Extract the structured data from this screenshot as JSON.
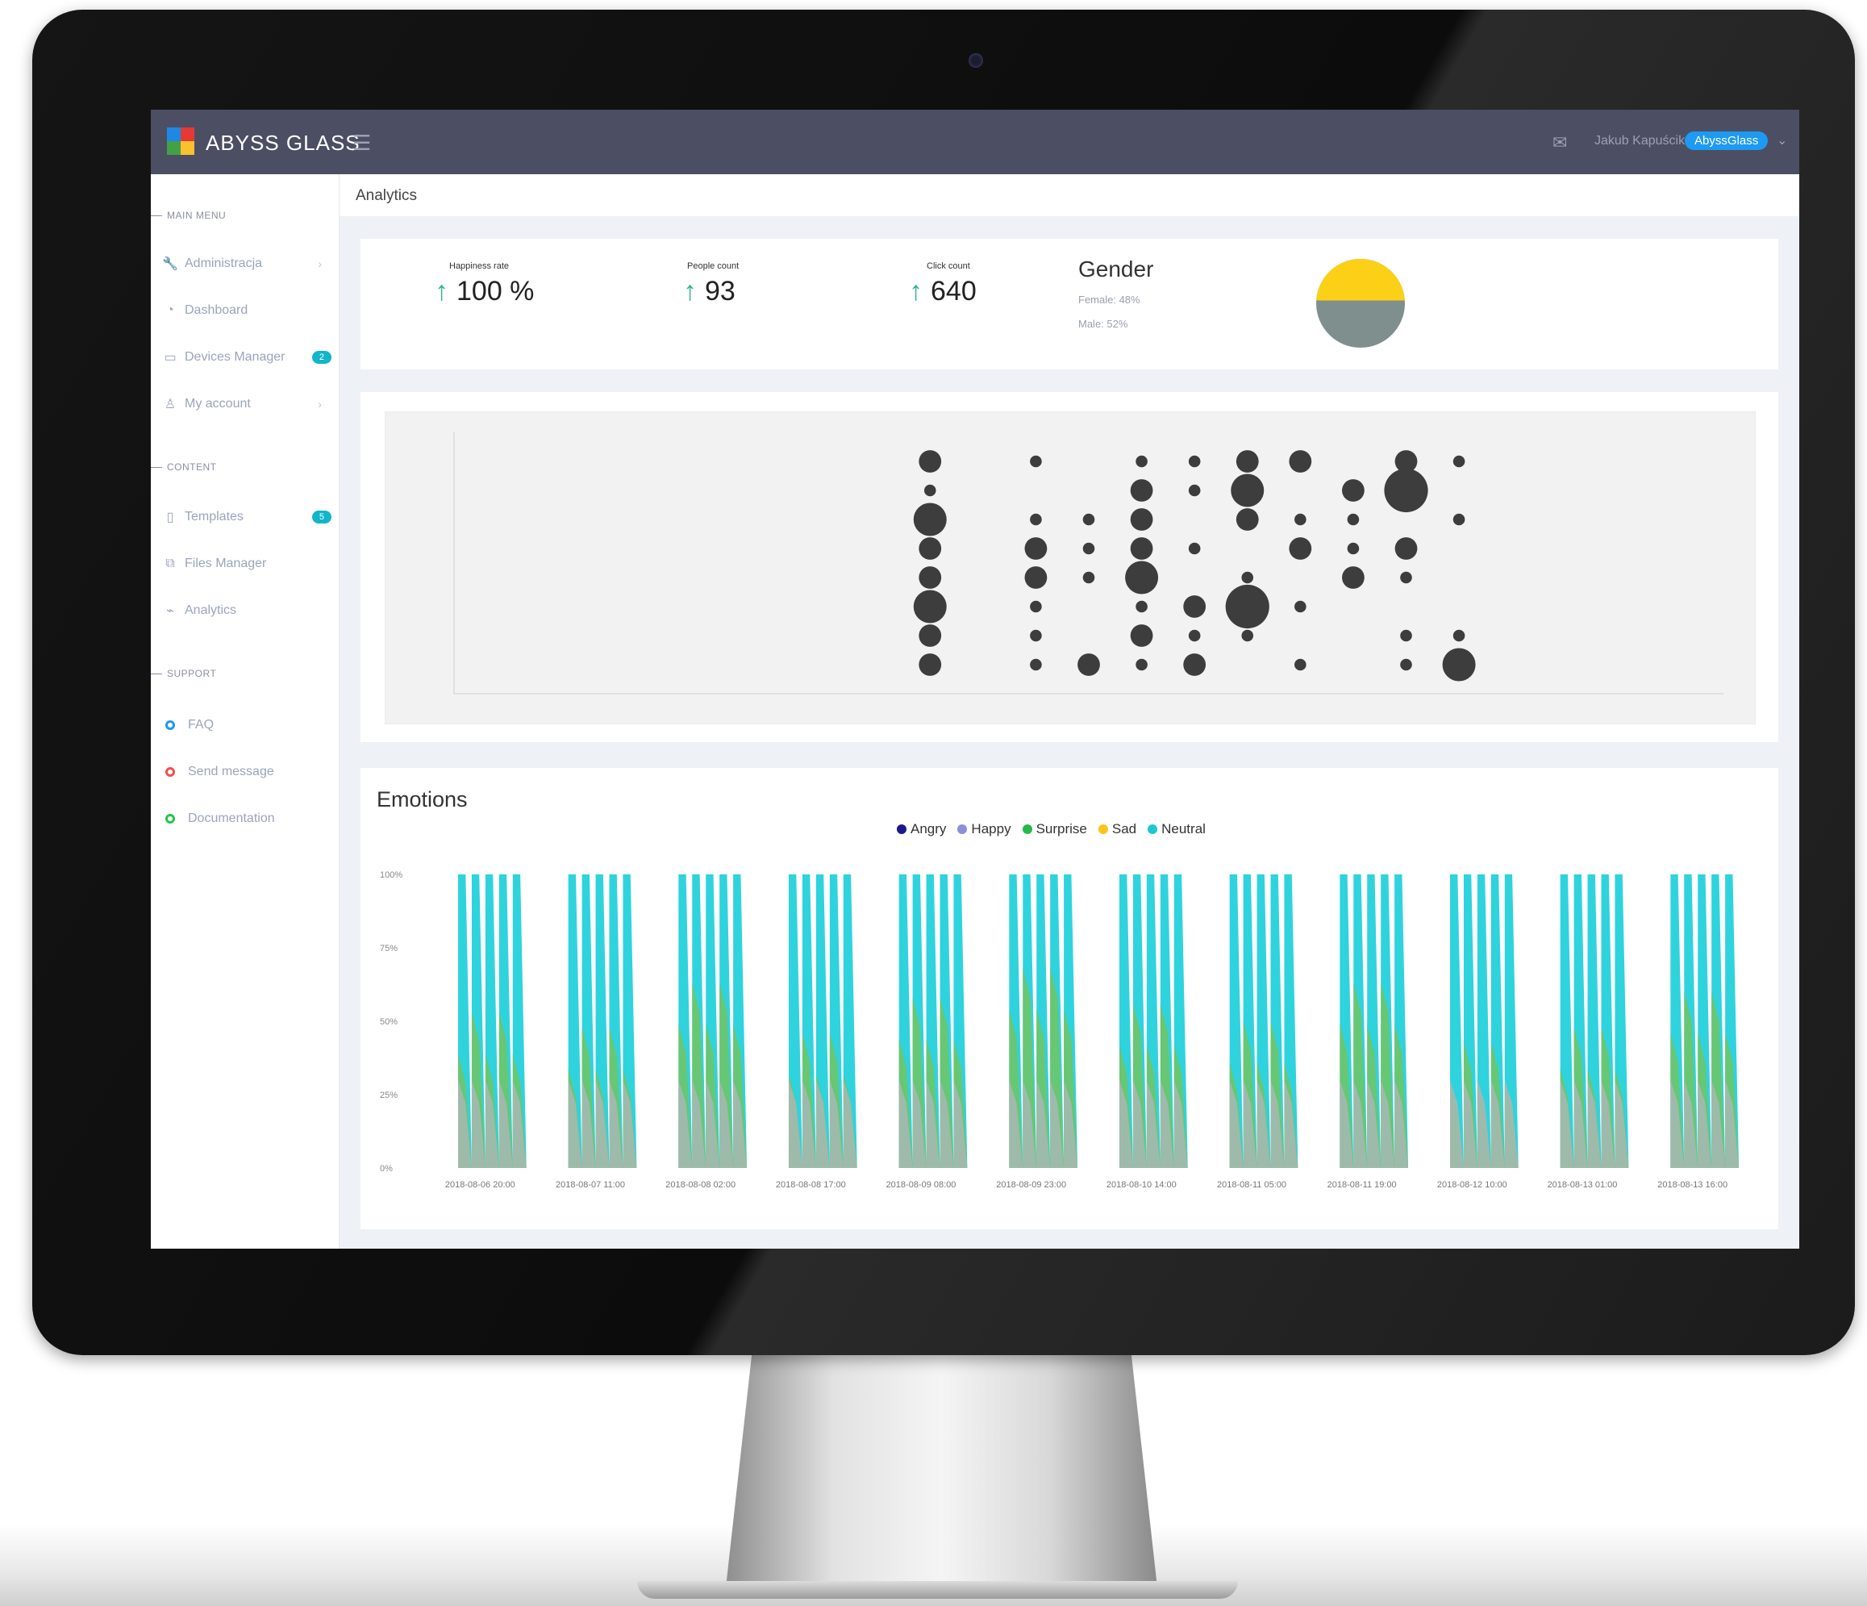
{
  "app": {
    "brand": "ABYSS GLASS",
    "user": "Jakub Kapuścik",
    "org_badge": "AbyssGlass"
  },
  "breadcrumb": "Analytics",
  "sidebar": {
    "sections": [
      {
        "label": "MAIN MENU"
      },
      {
        "label": "CONTENT"
      },
      {
        "label": "SUPPORT"
      }
    ],
    "items": [
      {
        "label": "Administracja",
        "icon": "wrench-icon"
      },
      {
        "label": "Dashboard",
        "icon": "dashboard-icon"
      },
      {
        "label": "Devices Manager",
        "icon": "monitor-icon",
        "badge": "2"
      },
      {
        "label": "My account",
        "icon": "user-icon"
      },
      {
        "label": "Templates",
        "icon": "document-icon",
        "badge": "5"
      },
      {
        "label": "Files Manager",
        "icon": "files-icon"
      },
      {
        "label": "Analytics",
        "icon": "chart-icon"
      },
      {
        "label": "FAQ",
        "icon": "ring-icon",
        "color": "#1e9af2"
      },
      {
        "label": "Send message",
        "icon": "ring-icon",
        "color": "#f05050"
      },
      {
        "label": "Documentation",
        "icon": "ring-icon",
        "color": "#27c24c"
      }
    ]
  },
  "stats": [
    {
      "label": "Happiness rate",
      "value": "100 %"
    },
    {
      "label": "People count",
      "value": "93"
    },
    {
      "label": "Click count",
      "value": "640"
    }
  ],
  "gender": {
    "title": "Gender",
    "female": "Female: 48%",
    "male": "Male: 52%",
    "female_fraction": 0.48,
    "colors": {
      "female": "#fcd016",
      "male": "#7f8f8d"
    }
  },
  "emotions": {
    "title": "Emotions",
    "legend": [
      {
        "name": "Angry",
        "color": "#1a1a8c"
      },
      {
        "name": "Happy",
        "color": "#8a8fd8"
      },
      {
        "name": "Surprise",
        "color": "#27b84a"
      },
      {
        "name": "Sad",
        "color": "#fcc419"
      },
      {
        "name": "Neutral",
        "color": "#1cc7d0"
      }
    ]
  },
  "chart_data": [
    {
      "type": "scatter",
      "title": "",
      "x": [
        9,
        9,
        9,
        9,
        9,
        9,
        9,
        9,
        11,
        11,
        11,
        11,
        11,
        11,
        11,
        12,
        12,
        12,
        12,
        13,
        13,
        13,
        13,
        13,
        13,
        13,
        13,
        14,
        14,
        14,
        14,
        14,
        14,
        15,
        15,
        15,
        15,
        15,
        15,
        16,
        16,
        16,
        16,
        16,
        17,
        17,
        17,
        17,
        18,
        18,
        18,
        18,
        18,
        18,
        19,
        19,
        19,
        19
      ],
      "y": [
        8,
        7,
        6,
        5,
        4,
        3,
        2,
        1,
        8,
        6,
        5,
        4,
        3,
        2,
        1,
        6,
        5,
        4,
        1,
        8,
        7,
        6,
        5,
        4,
        3,
        2,
        1,
        8,
        7,
        5,
        3,
        2,
        1,
        8,
        7,
        6,
        4,
        3,
        2,
        8,
        6,
        5,
        3,
        1,
        7,
        6,
        5,
        4,
        8,
        7,
        5,
        4,
        2,
        1,
        8,
        6,
        2,
        1
      ],
      "size": [
        3,
        1,
        5,
        3,
        3,
        5,
        3,
        3,
        1,
        1,
        3,
        3,
        1,
        1,
        1,
        1,
        1,
        1,
        3,
        1,
        3,
        3,
        3,
        5,
        1,
        3,
        1,
        1,
        1,
        1,
        3,
        1,
        3,
        3,
        5,
        3,
        1,
        7,
        1,
        3,
        1,
        3,
        1,
        1,
        3,
        1,
        1,
        3,
        3,
        7,
        3,
        1,
        1,
        1,
        1,
        1,
        1,
        5
      ],
      "xlim": [
        0,
        24
      ],
      "ylim": [
        0,
        9
      ]
    },
    {
      "type": "area",
      "title": "Emotions",
      "ylim": [
        0,
        100
      ],
      "y_ticks": [
        "100%",
        "75%",
        "50%",
        "25%",
        "0%"
      ],
      "x_ticks": [
        "2018-08-06 20:00",
        "2018-08-07 11:00",
        "2018-08-08 02:00",
        "2018-08-08 17:00",
        "2018-08-09 08:00",
        "2018-08-09 23:00",
        "2018-08-10 14:00",
        "2018-08-11 05:00",
        "2018-08-11 19:00",
        "2018-08-12 10:00",
        "2018-08-13 01:00",
        "2018-08-13 16:00"
      ],
      "series": [
        {
          "name": "Angry",
          "values": [
            0,
            0,
            0,
            0,
            0,
            0,
            0,
            0,
            0,
            0,
            0,
            0
          ]
        },
        {
          "name": "Happy",
          "values": [
            0,
            0,
            0,
            0,
            0,
            0,
            0,
            0,
            0,
            0,
            0,
            0
          ]
        },
        {
          "name": "Surprise",
          "values": [
            45,
            40,
            55,
            38,
            50,
            60,
            48,
            42,
            55,
            35,
            40,
            52
          ]
        },
        {
          "name": "Sad",
          "values": [
            0,
            0,
            0,
            0,
            0,
            0,
            0,
            0,
            0,
            0,
            0,
            0
          ]
        },
        {
          "name": "Neutral",
          "values": [
            55,
            60,
            45,
            62,
            50,
            40,
            52,
            58,
            45,
            65,
            60,
            48
          ]
        }
      ]
    }
  ]
}
